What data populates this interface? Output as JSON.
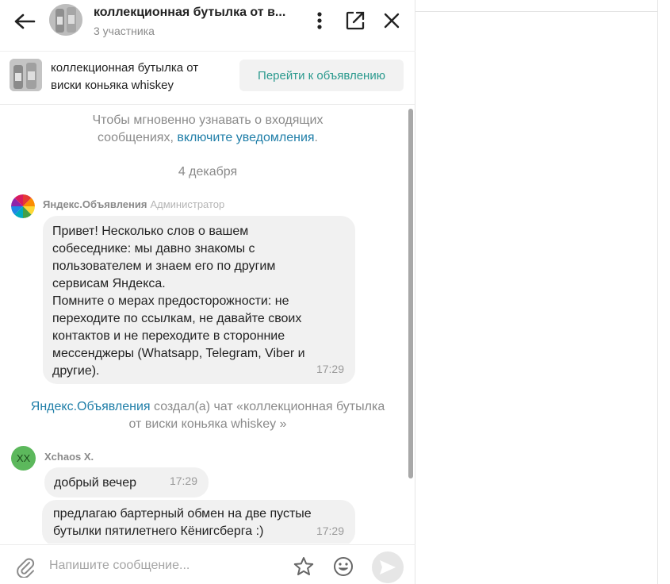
{
  "header": {
    "title": "коллекционная бутылка от в...",
    "participants": "3 участника",
    "icons": [
      "back-arrow-icon",
      "more-vertical-icon",
      "external-link-icon",
      "close-icon"
    ]
  },
  "listing": {
    "title": "коллекционная бутылка от виски коньяка whiskey",
    "goto_label": "Перейти к объявлению"
  },
  "notice": {
    "line1": "Чтобы мгновенно узнавать о входящих",
    "line2_prefix": "сообщениях,",
    "link": "включите уведомления",
    "line2_suffix": "."
  },
  "date_separator": "4 декабря",
  "messages": [
    {
      "sender": "Яндекс.Объявления",
      "role": "Администратор",
      "text": "Привет! Несколько слов о вашем\nсобеседнике: мы давно знакомы с\nпользователем и знаем его по другим\nсервисам Яндекса.\nПомните о мерах предосторожности: не\nпереходите по ссылкам, не давайте своих\nконтактов и не переходите в сторонние\nмессенджеры (Whatsapp, Telegram, Viber и\nдругие).",
      "time": "17:29"
    },
    {
      "avatar_initials": "XX",
      "sender": "Xchaos X.",
      "text": "добрый вечер",
      "time": "17:29"
    },
    {
      "text": "предлагаю бартерный обмен на две пустые\nбутылки пятилетнего Кёнигсберга :)",
      "time": "17:29"
    }
  ],
  "system_message": {
    "link": "Яндекс.Объявления",
    "text_rest": " создал(а) чат «коллекционная бутылка",
    "line2": "от виски коньяка whiskey »"
  },
  "composer": {
    "placeholder": "Напишите сообщение...",
    "icons": [
      "paperclip-icon",
      "star-icon",
      "smiley-icon",
      "send-icon"
    ]
  },
  "colors": {
    "accent_teal": "#2b9a8e",
    "link_blue": "#1f7ea8",
    "avatar_green": "#5cb85c",
    "bubble_bg": "#f1f1f1"
  }
}
